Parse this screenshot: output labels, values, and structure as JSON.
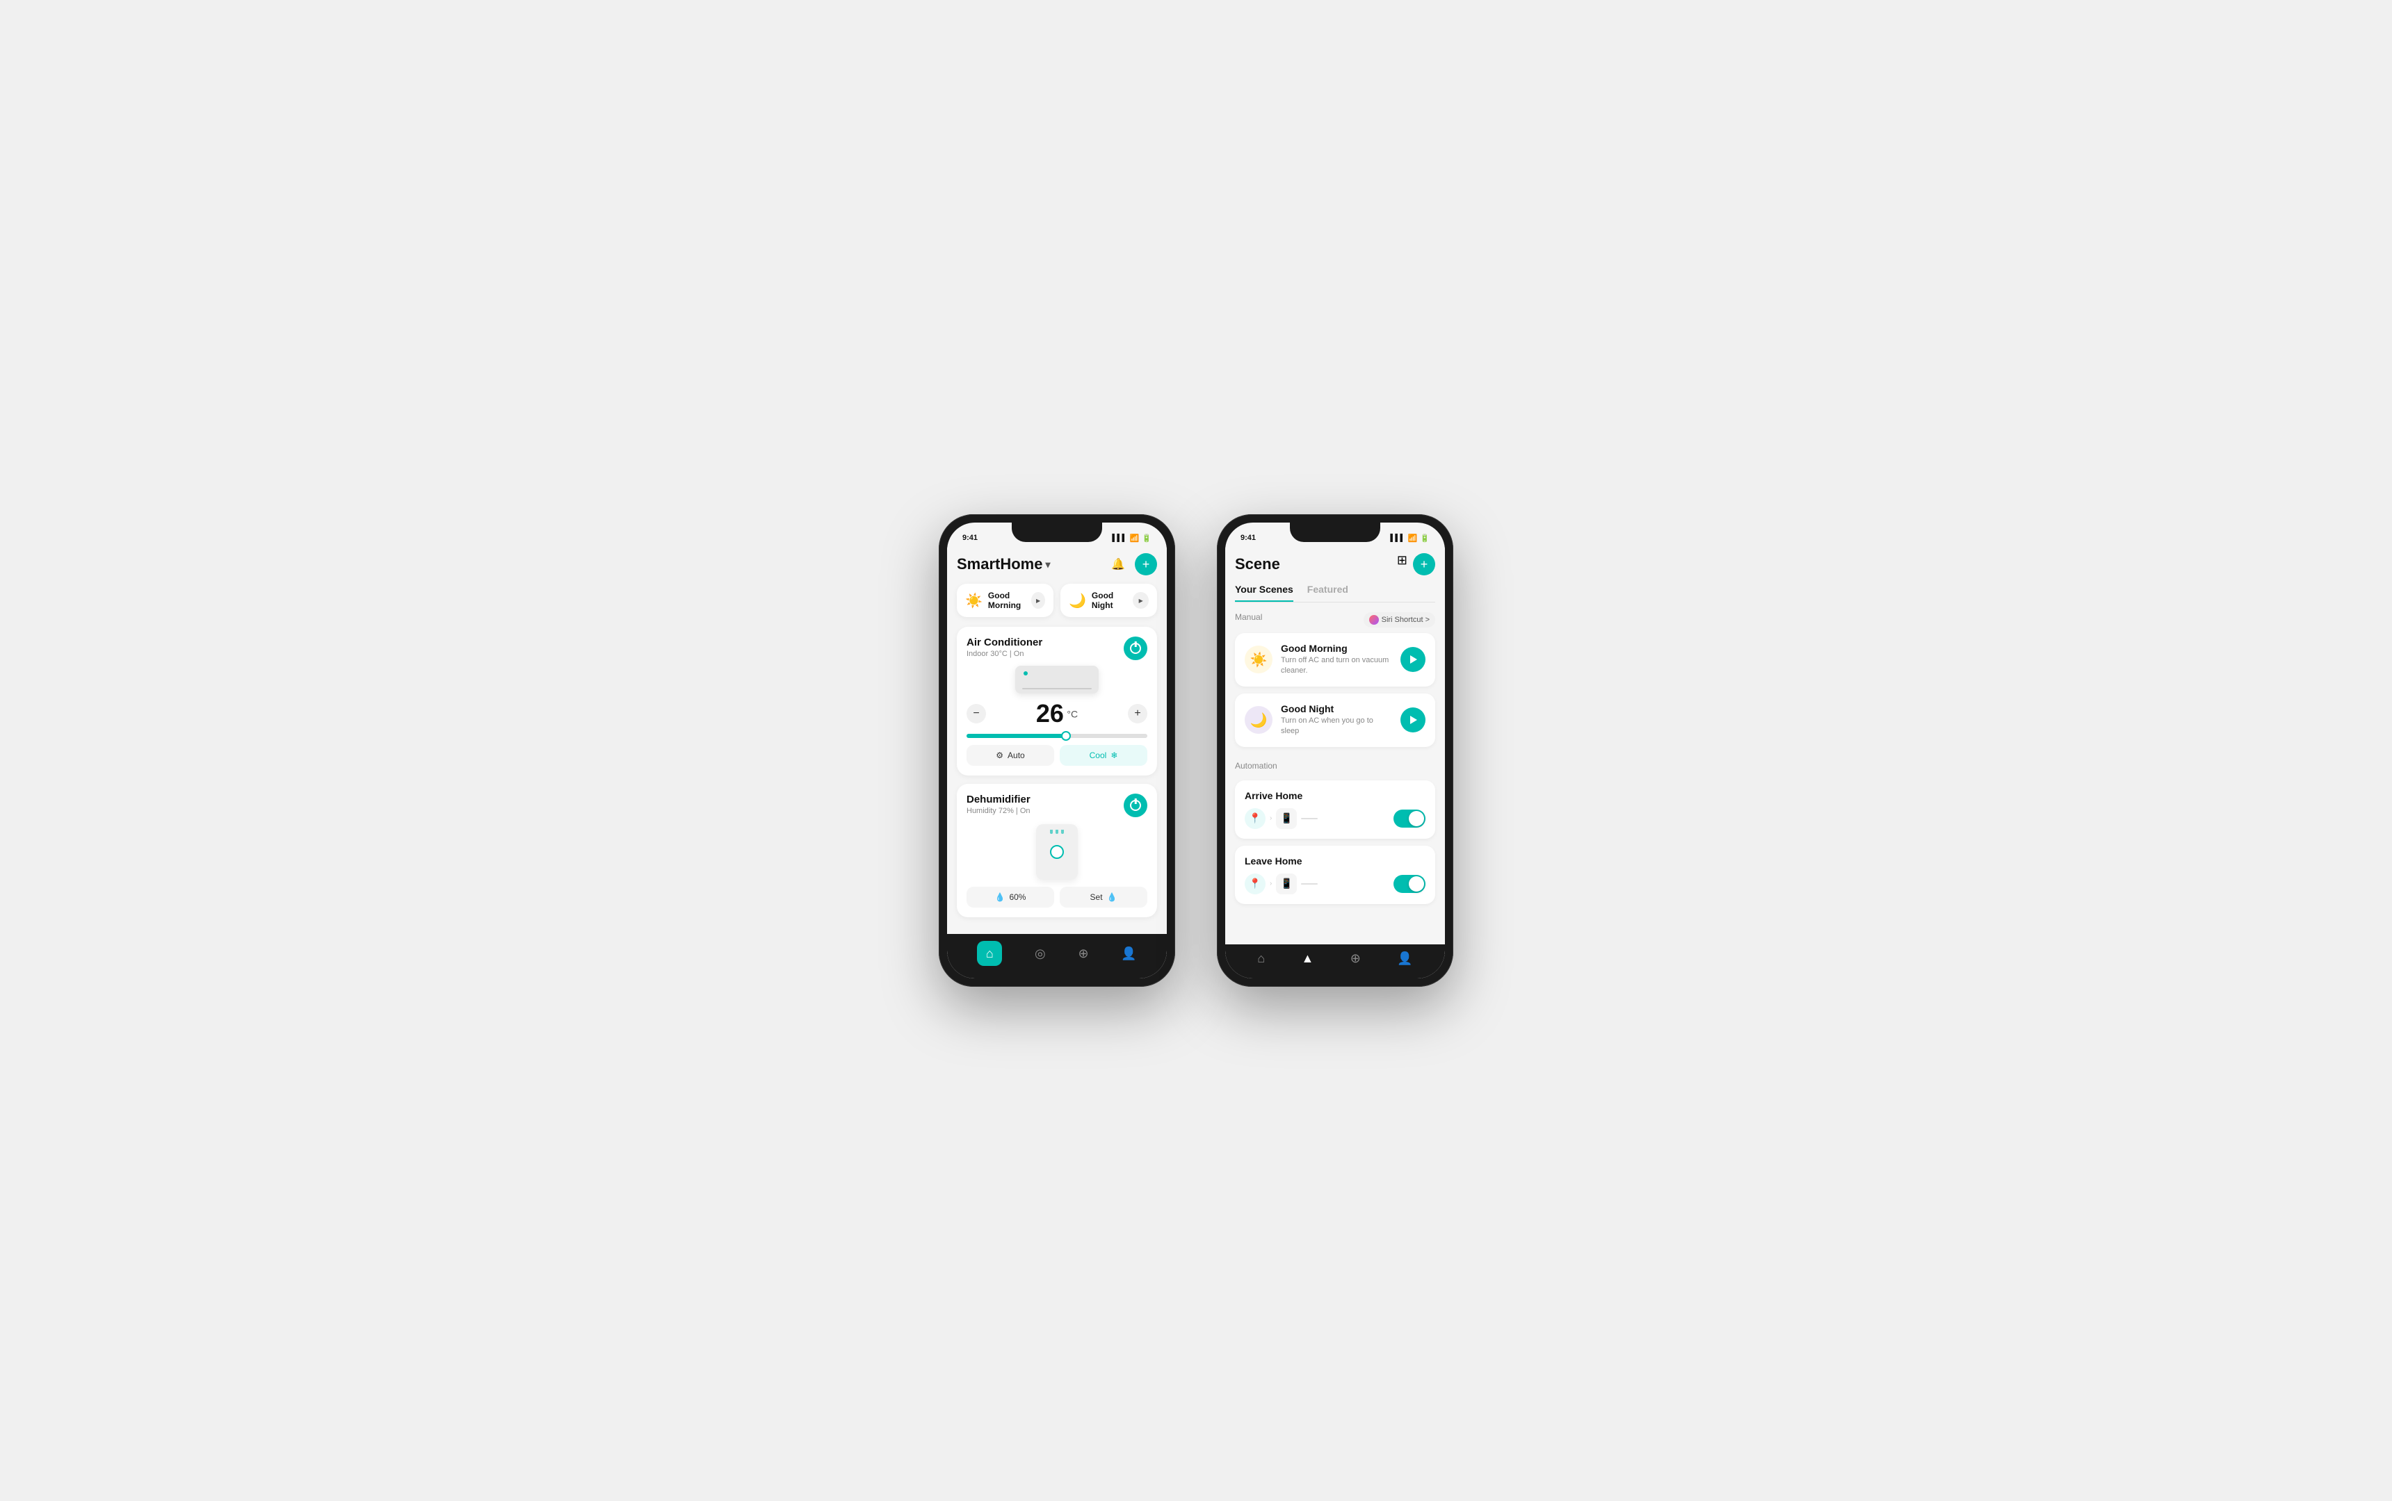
{
  "phone1": {
    "status": {
      "time": "9:41",
      "signal": "●●●",
      "wifi": "wifi",
      "battery": "battery"
    },
    "header": {
      "title": "SmartHome",
      "dropdown_icon": "▾"
    },
    "scenes": [
      {
        "emoji": "☀️",
        "label": "Good Morning",
        "play": "▶"
      },
      {
        "emoji": "🌙",
        "label": "Good Night",
        "play": "▶"
      }
    ],
    "devices": [
      {
        "name": "Air Conditioner",
        "status": "Indoor 30°C | On",
        "temperature": "26",
        "temp_unit": "°C",
        "modes": [
          {
            "label": "Auto",
            "icon": "⚙",
            "active": false
          },
          {
            "label": "Cool",
            "icon": "❄",
            "active": true
          }
        ],
        "slider_pct": 55
      },
      {
        "name": "Dehumidifier",
        "status": "Humidity 72% | On",
        "humidity_pct": "60%",
        "buttons": [
          {
            "label": "60%",
            "icon": "💧"
          },
          {
            "label": "Set",
            "icon": "💧"
          }
        ]
      }
    ],
    "tabs": [
      {
        "icon": "⌂",
        "active": true
      },
      {
        "icon": "◎",
        "active": false
      },
      {
        "icon": "⊕",
        "active": false
      },
      {
        "icon": "👤",
        "active": false
      }
    ]
  },
  "phone2": {
    "status": {
      "time": "9:41"
    },
    "header": {
      "title": "Scene"
    },
    "tabs": [
      {
        "label": "Your Scenes",
        "active": true
      },
      {
        "label": "Featured",
        "active": false
      }
    ],
    "manual_label": "Manual",
    "siri_label": "Siri Shortcut >",
    "scenes": [
      {
        "emoji": "☀️",
        "style": "morning",
        "title": "Good Morning",
        "desc": "Turn off AC and turn on vacuum cleaner."
      },
      {
        "emoji": "🌙",
        "style": "night",
        "title": "Good Night",
        "desc": "Turn on AC when you go to sleep"
      }
    ],
    "automation_label": "Automation",
    "automations": [
      {
        "title": "Arrive Home",
        "trigger_icon": "📍",
        "device_icon": "📱",
        "enabled": true
      },
      {
        "title": "Leave Home",
        "trigger_icon": "📍",
        "device_icon": "📱",
        "enabled": true
      }
    ],
    "nav_tabs": [
      {
        "icon": "⌂",
        "active": false
      },
      {
        "icon": "▲",
        "active": false
      },
      {
        "icon": "⊕",
        "active": false
      },
      {
        "icon": "👤",
        "active": false
      }
    ]
  }
}
